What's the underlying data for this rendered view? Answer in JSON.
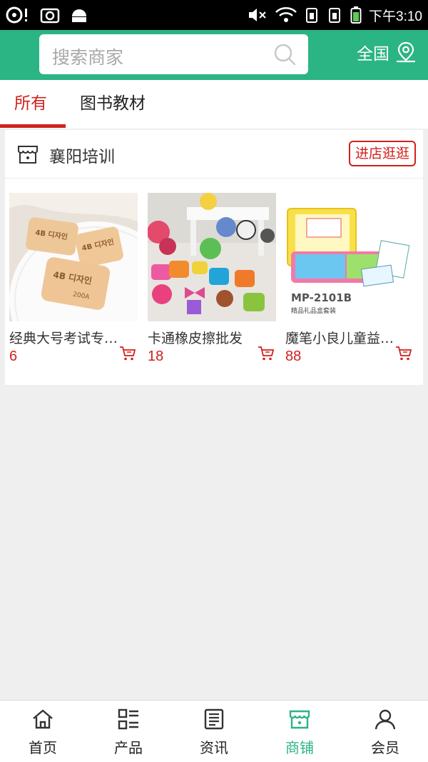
{
  "status_bar": {
    "time": "下午3:10"
  },
  "header": {
    "search": {
      "placeholder": "搜索商家"
    },
    "region": {
      "label": "全国"
    },
    "accent_color": "#2bb484"
  },
  "tabs": [
    {
      "label": "所有",
      "active": true
    },
    {
      "label": "图书教材",
      "active": false
    }
  ],
  "shop": {
    "name": "襄阳培训",
    "enter_label": "进店逛逛",
    "products": [
      {
        "name": "经典大号考试专用橡皮擦",
        "price": "6"
      },
      {
        "name": "卡通橡皮擦批发",
        "price": "18"
      },
      {
        "name": "魔笔小良儿童益智点读",
        "price": "88"
      }
    ]
  },
  "bottom_nav": [
    {
      "label": "首页",
      "icon": "home-icon",
      "active": false
    },
    {
      "label": "产品",
      "icon": "product-grid-icon",
      "active": false
    },
    {
      "label": "资讯",
      "icon": "news-icon",
      "active": false
    },
    {
      "label": "商铺",
      "icon": "store-icon",
      "active": true
    },
    {
      "label": "会员",
      "icon": "user-icon",
      "active": false
    }
  ],
  "colors": {
    "accent": "#2bb484",
    "highlight": "#d0211c"
  }
}
